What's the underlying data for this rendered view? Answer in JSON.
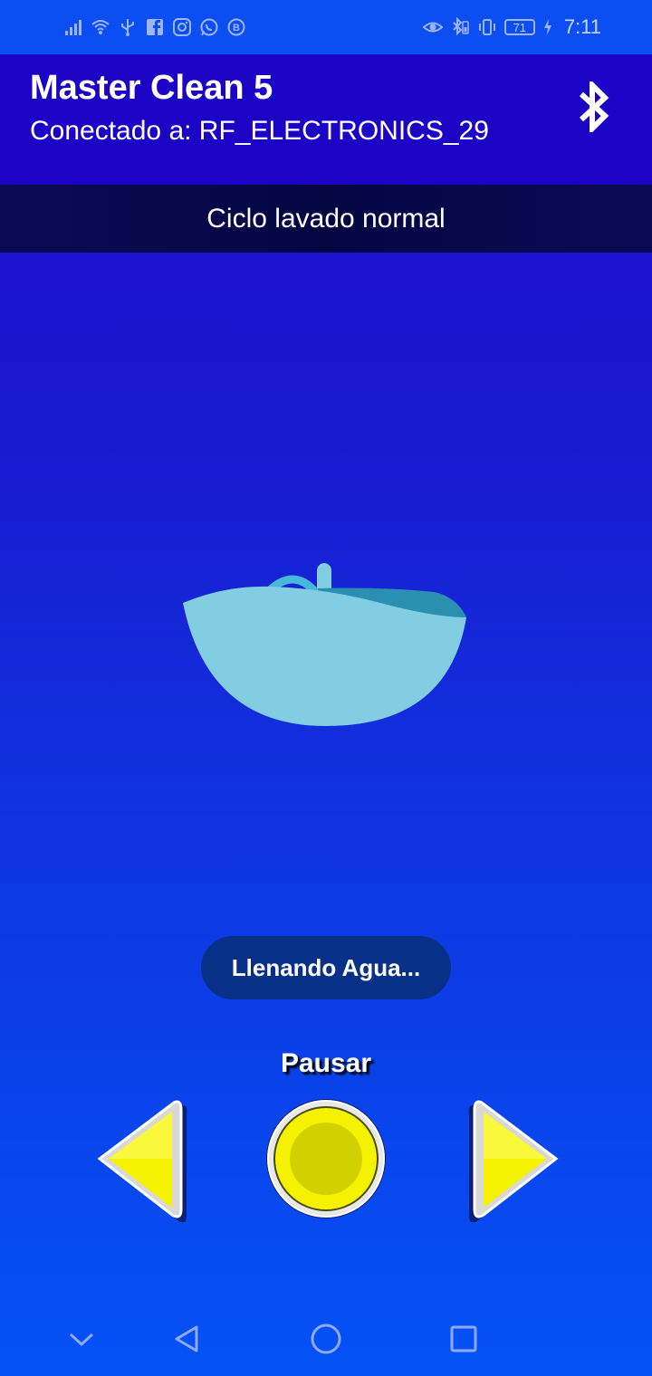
{
  "status_bar": {
    "time": "7:11",
    "battery_level": "71",
    "left_icons": [
      "signal-icon",
      "wifi-icon",
      "usb-icon",
      "facebook-icon",
      "instagram-icon",
      "whatsapp-icon",
      "b-badge-icon"
    ],
    "right_icons": [
      "eye-icon",
      "bluetooth-battery-icon",
      "vibrate-icon",
      "battery-icon",
      "charging-icon"
    ]
  },
  "app_bar": {
    "title": "Master Clean 5",
    "subtitle": "Conectado a: RF_ELECTRONICS_29",
    "action_icon": "bluetooth-icon"
  },
  "cycle": {
    "label": "Ciclo lavado normal"
  },
  "illustration": {
    "icon": "water-bowl-icon"
  },
  "status": {
    "text": "Llenando Agua..."
  },
  "controls": {
    "pause_label": "Pausar",
    "prev_icon": "arrow-left-icon",
    "play_icon": "play-circle-icon",
    "next_icon": "arrow-right-icon"
  },
  "nav_bar": {
    "icons": [
      "chevron-down-icon",
      "back-icon",
      "home-icon",
      "recents-icon"
    ]
  },
  "colors": {
    "status_bar": "#0b4ff2",
    "app_bar": "#1c04c6",
    "cycle_bar": "#040642",
    "status_pill": "#083089",
    "yellow_button": "#f5f200",
    "water": "#82cde2"
  }
}
